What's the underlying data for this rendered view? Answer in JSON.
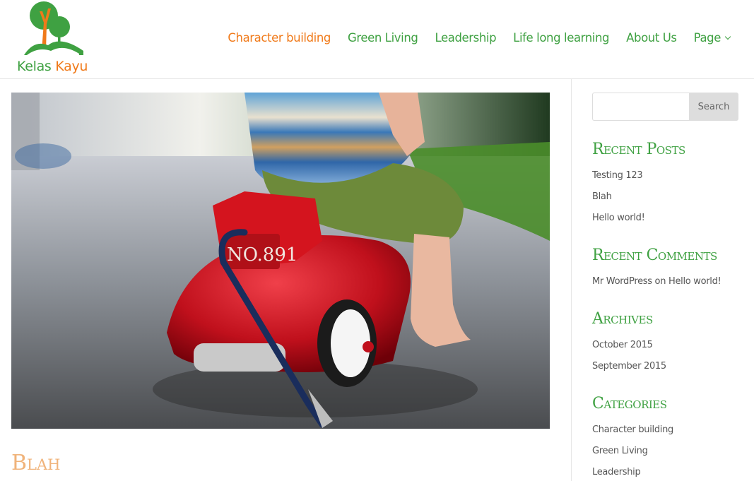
{
  "brand": {
    "name_part1": "Kelas",
    "name_part2": "Kayu",
    "color_green": "#3fa142",
    "color_orange": "#f07a1a",
    "logo_icon": "tree-logo-icon"
  },
  "nav": {
    "items": [
      {
        "label": "Character building",
        "active": true
      },
      {
        "label": "Green Living"
      },
      {
        "label": "Leadership"
      },
      {
        "label": "Life long learning"
      },
      {
        "label": "About Us"
      },
      {
        "label": "Page",
        "has_submenu": true
      }
    ]
  },
  "post": {
    "title": "Blah",
    "image_alt": "Child riding red toy car NO.891",
    "image_text": "NO.891"
  },
  "sidebar": {
    "search": {
      "placeholder": "",
      "button_label": "Search"
    },
    "recent_posts": {
      "title": "Recent Posts",
      "items": [
        "Testing 123",
        "Blah",
        "Hello world!"
      ]
    },
    "recent_comments": {
      "title": "Recent Comments",
      "items": [
        "Mr WordPress on Hello world!"
      ]
    },
    "archives": {
      "title": "Archives",
      "items": [
        "October 2015",
        "September 2015"
      ]
    },
    "categories": {
      "title": "Categories",
      "items": [
        "Character building",
        "Green Living",
        "Leadership"
      ]
    }
  }
}
